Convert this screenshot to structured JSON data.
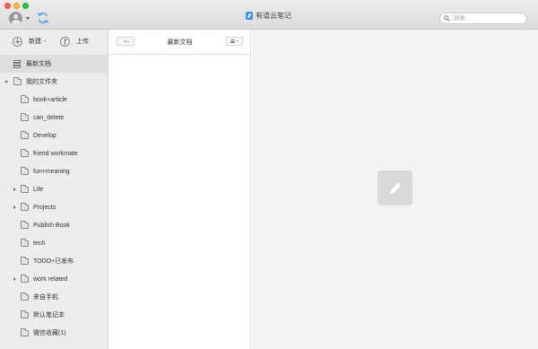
{
  "window": {
    "app_title": "有道云笔记",
    "colors": {
      "accent": "#3b8ff3",
      "sidebar_bg": "#ededed",
      "editor_bg": "#f3f3f3"
    }
  },
  "toolbar": {
    "search_placeholder": "搜索...",
    "new_label": "新建",
    "upload_label": "上传"
  },
  "sidebar": {
    "recent_label": "最新文档",
    "root_folder_label": "我的文件夹",
    "folders": [
      {
        "label": "book+article",
        "has_children": false
      },
      {
        "label": "can_delete",
        "has_children": false
      },
      {
        "label": "Develop",
        "has_children": false
      },
      {
        "label": "friend workmate",
        "has_children": false
      },
      {
        "label": "fun+meaning",
        "has_children": false
      },
      {
        "label": "Life",
        "has_children": true
      },
      {
        "label": "Projects",
        "has_children": true
      },
      {
        "label": "Publish Book",
        "has_children": false
      },
      {
        "label": "tech",
        "has_children": false
      },
      {
        "label": "TODO+已发布",
        "has_children": false
      },
      {
        "label": "work related",
        "has_children": true
      },
      {
        "label": "来自手机",
        "has_children": false
      },
      {
        "label": "默认笔记本",
        "has_children": false
      },
      {
        "label": "微信收藏(1)",
        "has_children": false
      }
    ]
  },
  "notelist": {
    "title": "最新文档"
  },
  "editor": {
    "empty_icon": "pencil-icon"
  }
}
